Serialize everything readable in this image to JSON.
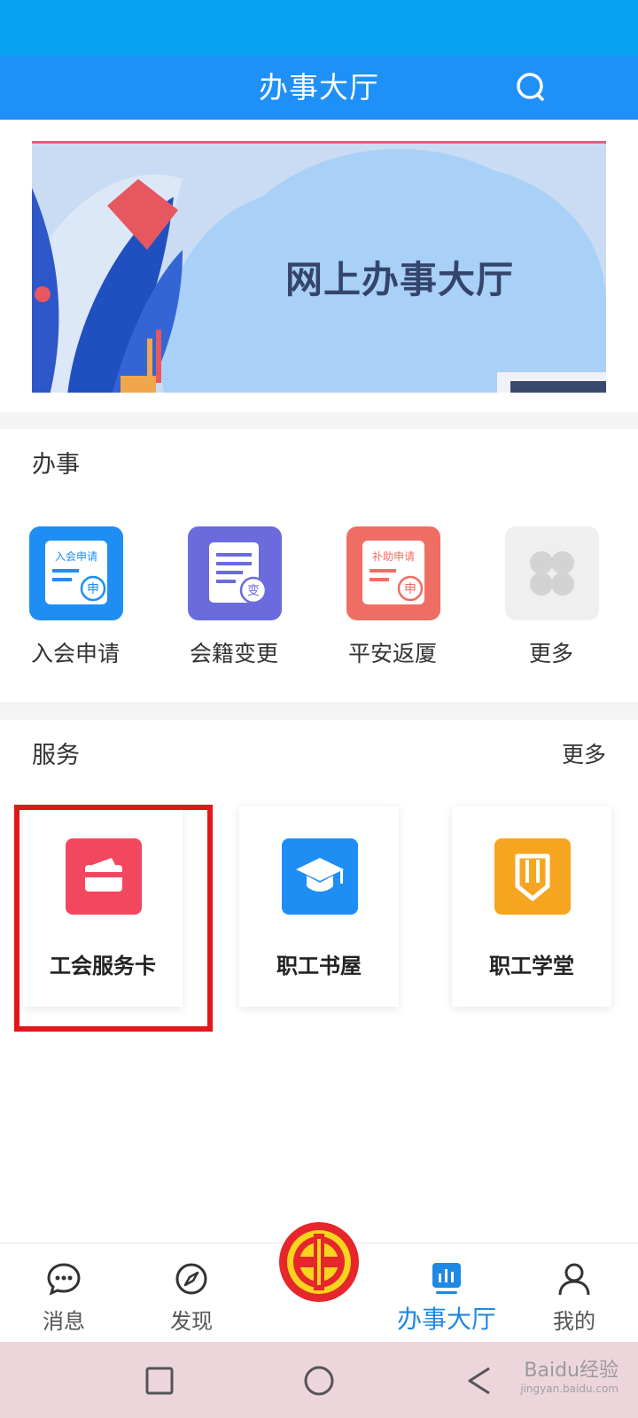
{
  "header": {
    "title": "办事大厅"
  },
  "banner": {
    "title": "网上办事大厅"
  },
  "handle_section": {
    "title": "办事",
    "items": [
      {
        "label": "入会申请",
        "icon_text": "入会申请",
        "badge": "申",
        "color": "#1e8ef4"
      },
      {
        "label": "会籍变更",
        "badge": "变",
        "color": "#6b6bde"
      },
      {
        "label": "平安返厦",
        "icon_text": "补助申请",
        "badge": "申",
        "color": "#ef6e63"
      },
      {
        "label": "更多",
        "color": "#efefef"
      }
    ]
  },
  "service_section": {
    "title": "服务",
    "more": "更多",
    "cards": [
      {
        "label": "工会服务卡",
        "icon": "card-icon",
        "color": "#f2475e"
      },
      {
        "label": "职工书屋",
        "icon": "graduation-cap-icon",
        "color": "#1e8ef4"
      },
      {
        "label": "职工学堂",
        "icon": "pencil-book-icon",
        "color": "#f6a521"
      }
    ]
  },
  "tabbar": {
    "items": [
      {
        "label": "消息",
        "icon": "message-icon"
      },
      {
        "label": "发现",
        "icon": "compass-icon"
      },
      {
        "label": "办事大厅",
        "icon": "chart-icon",
        "active": true
      },
      {
        "label": "我的",
        "icon": "user-icon"
      }
    ]
  },
  "watermark": {
    "brand": "Baidu经验",
    "url": "jingyan.baidu.com"
  },
  "colors": {
    "header": "#1e90f8",
    "status_bar": "#05a3f2",
    "highlight": "#e3161c",
    "active_tab": "#1e88e5"
  }
}
